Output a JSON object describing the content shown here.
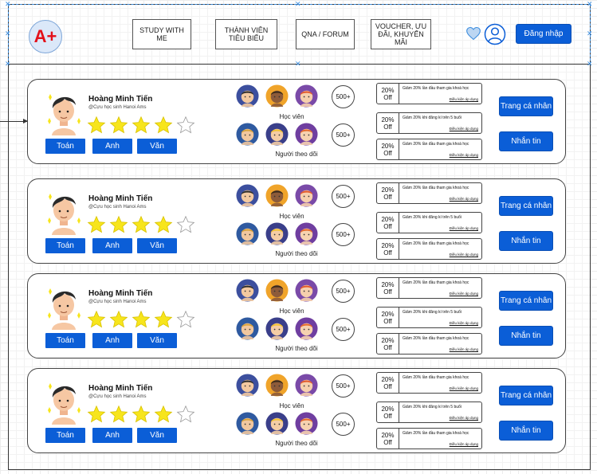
{
  "header": {
    "logo_text": "A+",
    "nav": [
      {
        "label": "STUDY WITH ME"
      },
      {
        "label": "THÀNH VIÊN TIÊU BIỂU"
      },
      {
        "label": "QNA / FORUM"
      },
      {
        "label": "VOUCHER, ƯU ĐÃI, KHUYẾN MÃI"
      }
    ],
    "login_label": "Đăng nhập"
  },
  "colors": {
    "accent": "#0b5ed7",
    "star": "#f7e51c",
    "logo_text": "#e3101a"
  },
  "cards": [
    {
      "name": "Hoàng Minh Tiến",
      "alumni": "@Cựu học sinh Hanoi Ams",
      "rating": 4,
      "rating_max": 5,
      "subjects": [
        "Toán",
        "Anh",
        "Văn"
      ],
      "students_count": "500+",
      "students_label": "Học viên",
      "followers_count": "500+",
      "followers_label": "Người theo dõi",
      "vouchers": [
        {
          "off": "20% Off",
          "title": "Giảm 20% lần đầu tham gia khoá học",
          "link": "Điều kiện áp dụng"
        },
        {
          "off": "20% Off",
          "title": "Giảm 20% khi đăng kí trên 5 buổi",
          "link": "Điều kiện áp dụng"
        },
        {
          "off": "20% Off",
          "title": "Giảm 20% lần đầu tham gia khoá học",
          "link": "Điều kiện áp dụng"
        }
      ],
      "profile_label": "Trang cá nhân",
      "message_label": "Nhắn tin"
    },
    {
      "name": "Hoàng Minh Tiến",
      "alumni": "@Cựu học sinh Hanoi Ams",
      "rating": 4,
      "rating_max": 5,
      "subjects": [
        "Toán",
        "Anh",
        "Văn"
      ],
      "students_count": "500+",
      "students_label": "Học viên",
      "followers_count": "500+",
      "followers_label": "Người theo dõi",
      "vouchers": [
        {
          "off": "20% Off",
          "title": "Giảm 20% lần đầu tham gia khoá học",
          "link": "Điều kiện áp dụng"
        },
        {
          "off": "20% Off",
          "title": "Giảm 20% khi đăng kí trên 5 buổi",
          "link": "Điều kiện áp dụng"
        },
        {
          "off": "20% Off",
          "title": "Giảm 20% lần đầu tham gia khoá học",
          "link": "Điều kiện áp dụng"
        }
      ],
      "profile_label": "Trang cá nhân",
      "message_label": "Nhắn tin"
    },
    {
      "name": "Hoàng Minh Tiến",
      "alumni": "@Cựu học sinh Hanoi Ams",
      "rating": 4,
      "rating_max": 5,
      "subjects": [
        "Toán",
        "Anh",
        "Văn"
      ],
      "students_count": "500+",
      "students_label": "Học viên",
      "followers_count": "500+",
      "followers_label": "Người theo dõi",
      "vouchers": [
        {
          "off": "20% Off",
          "title": "Giảm 20% lần đầu tham gia khoá học",
          "link": "Điều kiện áp dụng"
        },
        {
          "off": "20% Off",
          "title": "Giảm 20% khi đăng kí trên 5 buổi",
          "link": "Điều kiện áp dụng"
        },
        {
          "off": "20% Off",
          "title": "Giảm 20% lần đầu tham gia khoá học",
          "link": "Điều kiện áp dụng"
        }
      ],
      "profile_label": "Trang cá nhân",
      "message_label": "Nhắn tin"
    },
    {
      "name": "Hoàng Minh Tiến",
      "alumni": "@Cựu học sinh Hanoi Ams",
      "rating": 4,
      "rating_max": 5,
      "subjects": [
        "Toán",
        "Anh",
        "Văn"
      ],
      "students_count": "500+",
      "students_label": "Học viên",
      "followers_count": "500+",
      "followers_label": "Người theo dõi",
      "vouchers": [
        {
          "off": "20% Off",
          "title": "Giảm 20% lần đầu tham gia khoá học",
          "link": "Điều kiện áp dụng"
        },
        {
          "off": "20% Off",
          "title": "Giảm 20% khi đăng kí trên 5 buổi",
          "link": "Điều kiện áp dụng"
        },
        {
          "off": "20% Off",
          "title": "Giảm 20% lần đầu tham gia khoá học",
          "link": "Điều kiện áp dụng"
        }
      ],
      "profile_label": "Trang cá nhân",
      "message_label": "Nhắn tin"
    }
  ]
}
